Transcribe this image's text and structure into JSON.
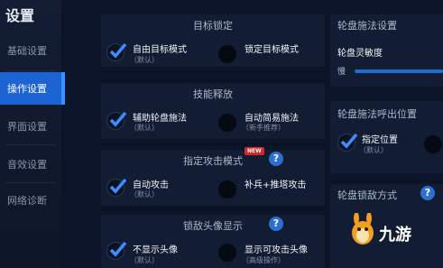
{
  "sidebar": {
    "title": "设置",
    "items": [
      {
        "label": "基础设置"
      },
      {
        "label": "操作设置"
      },
      {
        "label": "界面设置"
      },
      {
        "label": "音效设置"
      },
      {
        "label": "网络诊断"
      }
    ]
  },
  "sections": {
    "target_lock": {
      "title": "目标锁定",
      "option_left": {
        "label": "自由目标模式",
        "sub": "（默认）",
        "checked": true
      },
      "option_right": {
        "label": "锁定目标模式",
        "checked": false
      }
    },
    "skill_release": {
      "title": "技能释放",
      "option_left": {
        "label": "辅助轮盘施法",
        "sub": "（默认）",
        "checked": true
      },
      "option_right": {
        "label": "自动简易施法",
        "sub": "（新手推荐）",
        "checked": false
      }
    },
    "attack_mode": {
      "title": "指定攻击模式",
      "badge": "NEW",
      "help": "?",
      "option_left": {
        "label": "自动攻击",
        "sub": "（默认）",
        "checked": true
      },
      "option_right": {
        "label": "补兵+推塔攻击",
        "checked": false
      }
    },
    "enemy_avatar": {
      "title": "锁敌头像显示",
      "help": "?",
      "option_left": {
        "label": "不显示头像",
        "sub": "（默认）",
        "checked": true
      },
      "option_right": {
        "label": "显示可攻击头像",
        "sub": "（高级操作）",
        "checked": false
      }
    },
    "wheel_settings": {
      "title": "轮盘施法设置",
      "sensitivity_label": "轮盘灵敏度",
      "slow_label": "慢"
    },
    "wheel_popup": {
      "title": "轮盘施法呼出位置",
      "option": {
        "label": "指定位置",
        "sub": "（默认）",
        "checked": true
      }
    },
    "wheel_cancel": {
      "title": "轮盘锁敌方式",
      "help": "?"
    }
  },
  "watermark": {
    "text": "九游"
  },
  "colors": {
    "accent": "#1c63d4",
    "panel": "#121c32",
    "background": "#0b1428"
  }
}
